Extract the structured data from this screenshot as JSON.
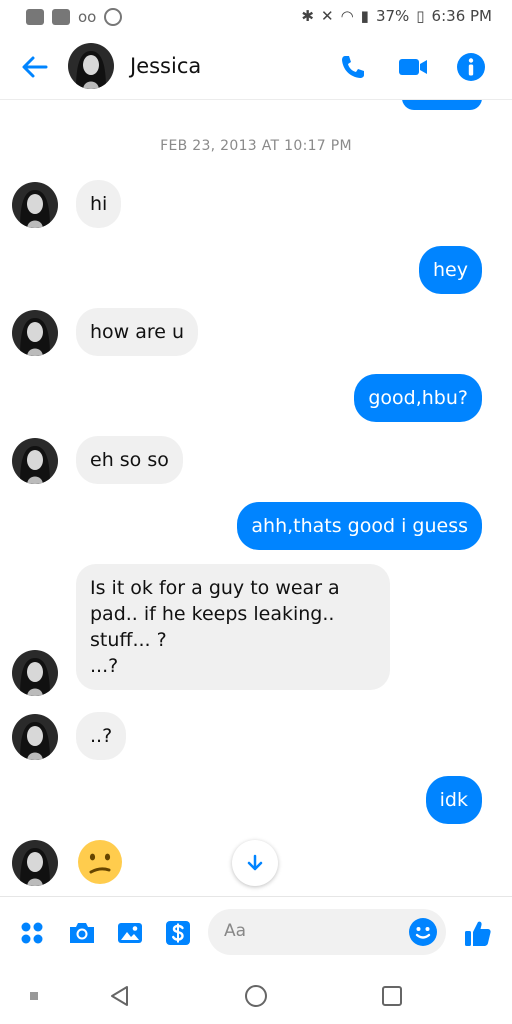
{
  "status_bar": {
    "battery": "37%",
    "time": "6:36 PM"
  },
  "header": {
    "contact_name": "Jessica"
  },
  "conversation": {
    "timestamp": "FEB 23, 2013 AT 10:17 PM",
    "messages": [
      {
        "from": "them",
        "text": "hi"
      },
      {
        "from": "me",
        "text": "hey"
      },
      {
        "from": "them",
        "text": "how are u"
      },
      {
        "from": "me",
        "text": "good,hbu?"
      },
      {
        "from": "them",
        "text": "eh so so"
      },
      {
        "from": "me",
        "text": "ahh,thats good i guess"
      },
      {
        "from": "them",
        "lines": [
          "Is it ok for a guy to wear a",
          "pad.. if he keeps leaking..",
          "stuff... ?",
          "...?"
        ]
      },
      {
        "from": "them",
        "text": "..?"
      },
      {
        "from": "me",
        "text": "idk"
      },
      {
        "from": "them",
        "emoji": "confused-face"
      }
    ]
  },
  "composer": {
    "placeholder": "Aa"
  },
  "colors": {
    "accent": "#0084ff",
    "incoming_bubble": "#f0f0f0",
    "emoji_yellow": "#ffcc4d"
  },
  "icons": [
    "back-arrow-icon",
    "phone-icon",
    "video-camera-icon",
    "info-icon",
    "more-dots-icon",
    "camera-icon",
    "image-icon",
    "payment-icon",
    "emoji-icon",
    "thumbs-up-icon",
    "arrow-down-icon",
    "nav-back-icon",
    "nav-home-icon",
    "nav-recents-icon"
  ]
}
